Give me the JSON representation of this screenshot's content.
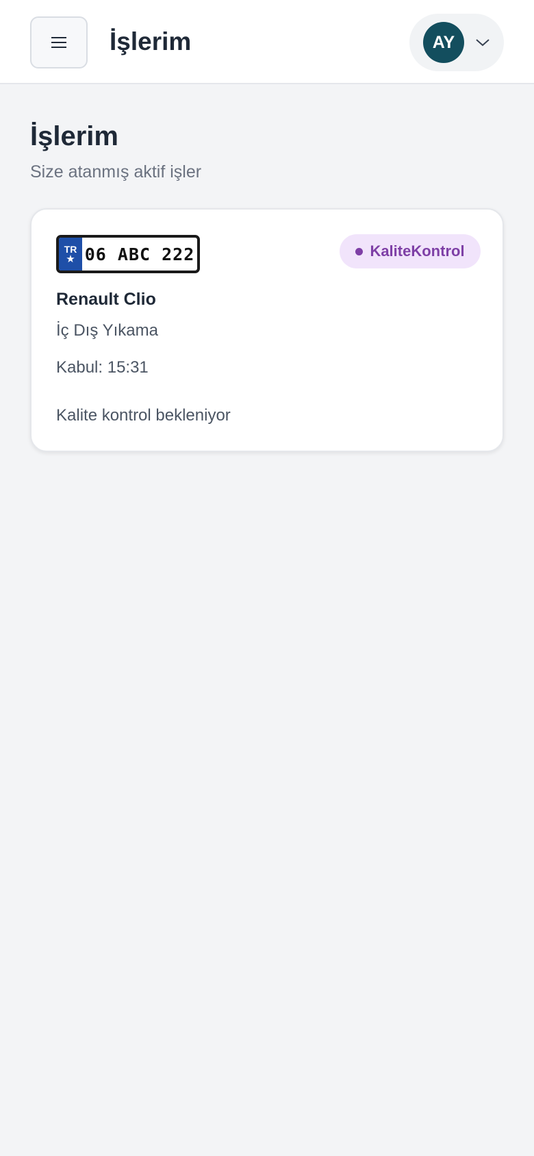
{
  "header": {
    "menu_icon": "hamburger-icon",
    "title": "İşlerim",
    "user": {
      "initials": "AY",
      "avatar_color": "#134e5e",
      "dropdown_icon": "chevron-down-icon"
    }
  },
  "page": {
    "title": "İşlerim",
    "subtitle": "Size atanmış aktif işler"
  },
  "jobs": [
    {
      "plate": {
        "country_code": "TR",
        "number": "06 ABC 222"
      },
      "status": {
        "label": "KaliteKontrol",
        "color": "#7e3fa6",
        "background": "#f1e4fb"
      },
      "vehicle": "Renault Clio",
      "service": "İç Dış Yıkama",
      "accepted": "Kabul: 15:31",
      "note": "Kalite kontrol bekleniyor"
    }
  ]
}
